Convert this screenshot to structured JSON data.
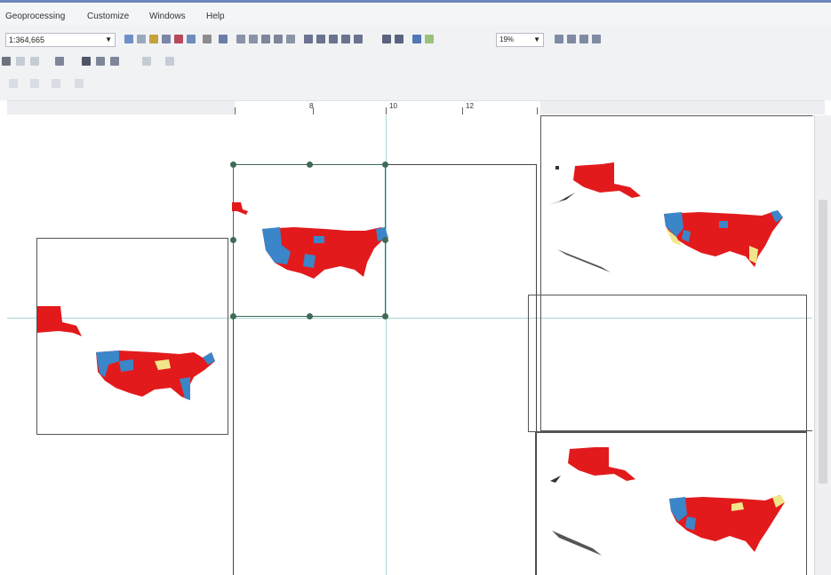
{
  "menu": [
    "Geoprocessing",
    "Customize",
    "Windows",
    "Help"
  ],
  "toolbar": {
    "scale_value": "1:364,665",
    "zoom_value": "19%"
  },
  "ruler": {
    "labels": [
      "8",
      "10",
      "12"
    ]
  },
  "icons": {
    "dropdown": "chevron-down-icon",
    "select": "select-elements-icon",
    "zoom": "zoom-icon"
  },
  "colors": {
    "red_party": "#e31a1c",
    "blue_party": "#3a86c8",
    "yellow_party": "#f2e68a",
    "guide": "#a9d6d6",
    "handle": "#3f6b55"
  }
}
